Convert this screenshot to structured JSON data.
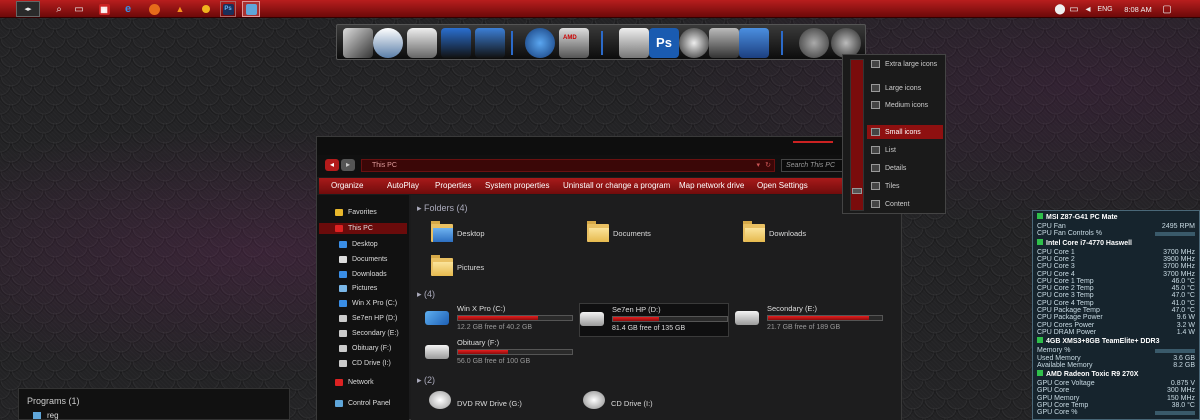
{
  "taskbar": {
    "time": "8:08 AM",
    "lang": "ENG"
  },
  "explorer": {
    "address": "This PC",
    "search_placeholder": "Search This PC",
    "commands": [
      "Organize",
      "AutoPlay",
      "Properties",
      "System properties",
      "Uninstall or change a program",
      "Map network drive",
      "Open Settings"
    ],
    "nav": {
      "favorites": "Favorites",
      "this_pc": "This PC",
      "items": [
        "Desktop",
        "Documents",
        "Downloads",
        "Pictures",
        "Win X Pro (C:)",
        "Se7en HP (D:)",
        "Secondary (E:)",
        "Obituary (F:)",
        "CD Drive (I:)"
      ],
      "network": "Network",
      "control_panel": "Control Panel"
    },
    "folders_group": "Folders (4)",
    "folders": [
      "Desktop",
      "Documents",
      "Downloads",
      "Pictures"
    ],
    "drives_group": "(4)",
    "drives": [
      {
        "name": "Win X Pro (C:)",
        "free": "12.2 GB free of 40.2 GB",
        "used_fraction": 0.7
      },
      {
        "name": "Se7en HP (D:)",
        "free": "81.4 GB free of 135 GB",
        "used_fraction": 0.4
      },
      {
        "name": "Secondary (E:)",
        "free": "21.7 GB free of 189 GB",
        "used_fraction": 0.89
      },
      {
        "name": "Obituary (F:)",
        "free": "56.0 GB free of 100 GB",
        "used_fraction": 0.44
      }
    ],
    "devices_group": "(2)",
    "devices": [
      "DVD RW Drive (G:)",
      "CD Drive (I:)"
    ]
  },
  "viewmenu": [
    "Extra large icons",
    "Large icons",
    "Medium icons",
    "Small icons",
    "List",
    "Details",
    "Tiles",
    "Content"
  ],
  "sensor": {
    "board": "MSI Z87-G41 PC Mate",
    "board_rows": [
      [
        "CPU Fan",
        "2495 RPM"
      ],
      [
        "CPU Fan Controls %",
        ""
      ]
    ],
    "cpu": "Intel Core i7-4770 Haswell",
    "cpu_rows": [
      [
        "CPU Core 1",
        "3700 MHz"
      ],
      [
        "CPU Core 2",
        "3900 MHz"
      ],
      [
        "CPU Core 3",
        "3700 MHz"
      ],
      [
        "CPU Core 4",
        "3700 MHz"
      ],
      [
        "CPU Core 1 Temp",
        "46.0 °C"
      ],
      [
        "CPU Core 2 Temp",
        "45.0 °C"
      ],
      [
        "CPU Core 3 Temp",
        "47.0 °C"
      ],
      [
        "CPU Core 4 Temp",
        "41.0 °C"
      ],
      [
        "CPU Package Temp",
        "47.0 °C"
      ],
      [
        "CPU Package Power",
        "9.6 W"
      ],
      [
        "CPU Cores Power",
        "3.2 W"
      ],
      [
        "CPU DRAM Power",
        "1.4 W"
      ]
    ],
    "mem": "4GB XMS3+8GB TeamElite+ DDR3",
    "mem_rows": [
      [
        "Memory %",
        ""
      ],
      [
        "Used Memory",
        "3.6 GB"
      ],
      [
        "Available Memory",
        "8.2 GB"
      ]
    ],
    "gpu": "AMD Radeon Toxic R9 270X",
    "gpu_rows": [
      [
        "GPU Core Voltage",
        "0.875 V"
      ],
      [
        "GPU Core",
        "300 MHz"
      ],
      [
        "GPU Memory",
        "150 MHz"
      ],
      [
        "GPU Core Temp",
        "38.0 °C"
      ],
      [
        "GPU Core %",
        ""
      ]
    ]
  },
  "programs": {
    "title": "Programs (1)",
    "item": "reg"
  }
}
